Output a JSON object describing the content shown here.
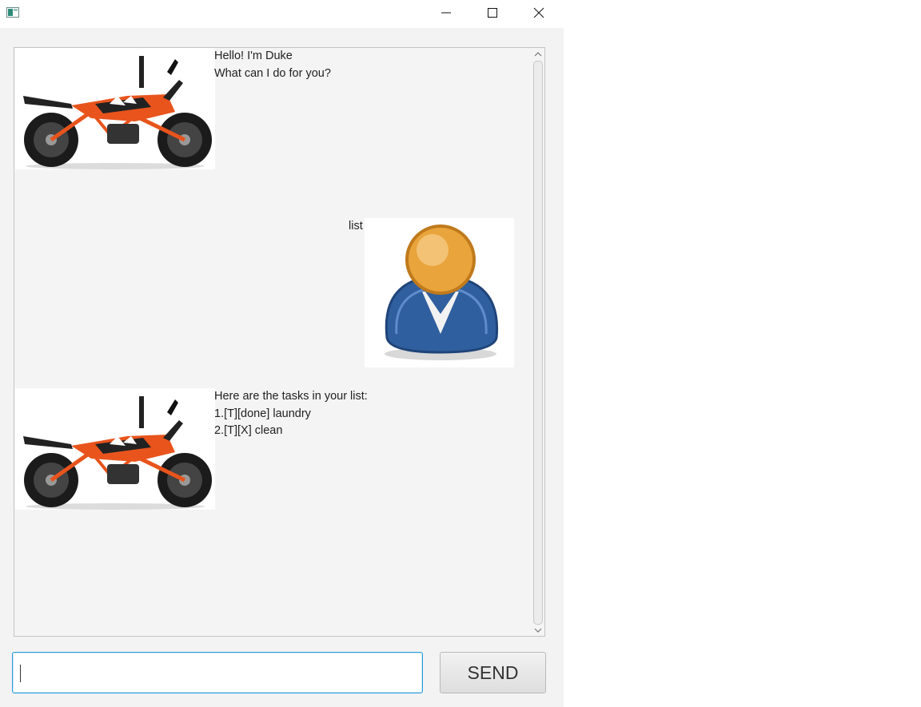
{
  "window": {
    "icon": "app-window-icon",
    "controls": [
      "minimize-icon",
      "maximize-icon",
      "close-icon"
    ]
  },
  "dialog": [
    {
      "speaker": "duke",
      "avatar": "motorcycle-avatar",
      "text": "Hello! I'm Duke\nWhat can I do for you?"
    },
    {
      "speaker": "user",
      "avatar": "user-avatar",
      "text": "list"
    },
    {
      "speaker": "duke",
      "avatar": "motorcycle-avatar",
      "text": "Here are the tasks in your list:\n1.[T][done] laundry\n2.[T][X] clean"
    }
  ],
  "input": {
    "value": "",
    "placeholder": ""
  },
  "send_button": {
    "label": "SEND"
  },
  "colors": {
    "window_bg": "#f3f3f3",
    "input_focus_border": "#2a9bdb",
    "bike_orange": "#e8541c",
    "user_body_blue": "#2f5f9e",
    "user_head_orange": "#e9a43c"
  }
}
